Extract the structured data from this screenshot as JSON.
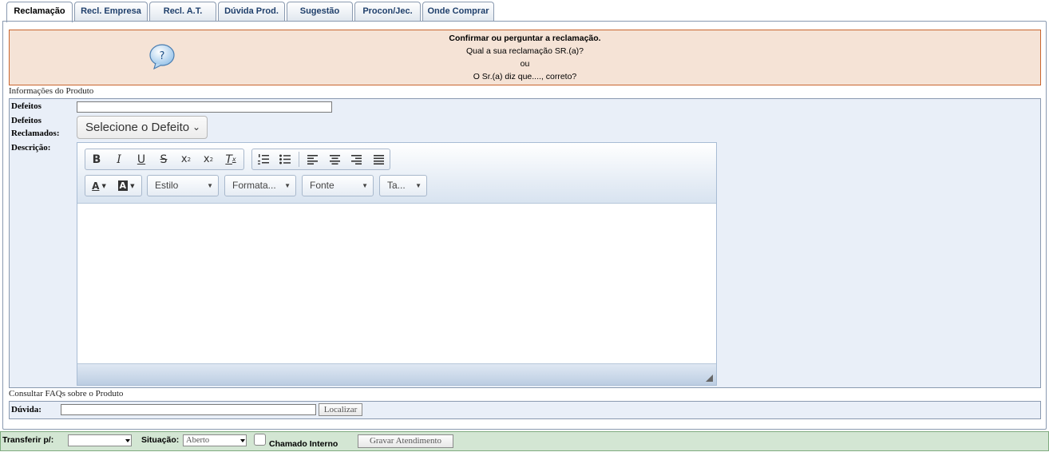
{
  "tabs": [
    {
      "label": "Reclamação",
      "active": true
    },
    {
      "label": "Recl. Empresa"
    },
    {
      "label": "Recl. A.T."
    },
    {
      "label": "Dúvida Prod."
    },
    {
      "label": "Sugestão"
    },
    {
      "label": "Procon/Jec."
    },
    {
      "label": "Onde Comprar"
    }
  ],
  "alert": {
    "line1": "Confirmar ou perguntar a reclamação.",
    "line2": "Qual a sua reclamação SR.(a)?",
    "line3": "ou",
    "line4": "O Sr.(a) diz que...., correto?",
    "icon": "question-bubble-icon",
    "bg": "#f5e3d6",
    "border": "#c9652e"
  },
  "product": {
    "section_title": "Informações do Produto",
    "defeitos_label": "Defeitos",
    "defeitos_value": "",
    "reclamados_label1": "Defeitos",
    "reclamados_label2": "Reclamados:",
    "select_defeito": "Selecione o Defeito",
    "descricao_label": "Descrição:"
  },
  "editor": {
    "buttons": [
      "bold-icon",
      "italic-icon",
      "underline-icon",
      "strikethrough-icon",
      "subscript-icon",
      "superscript-icon",
      "remove-format-icon",
      "numbered-list-icon",
      "bulleted-list-icon",
      "align-left-icon",
      "align-center-icon",
      "align-right-icon",
      "justify-icon",
      "text-color-icon",
      "background-color-icon"
    ],
    "combo_estilo": "Estilo",
    "combo_formato": "Formata...",
    "combo_fonte": "Fonte",
    "combo_tamanho": "Ta...",
    "content": ""
  },
  "faq": {
    "section_title": "Consultar FAQs sobre o Produto",
    "duvida_label": "Dúvida:",
    "duvida_value": "",
    "localizar_label": "Localizar"
  },
  "footer": {
    "transferir_label": "Transferir p/:",
    "transferir_value": "",
    "situacao_label": "Situação:",
    "situacao_value": "Aberto",
    "chamado_label": "Chamado Interno",
    "chamado_checked": false,
    "gravar_label": "Gravar Atendimento",
    "bg": "#d3e6d3"
  }
}
